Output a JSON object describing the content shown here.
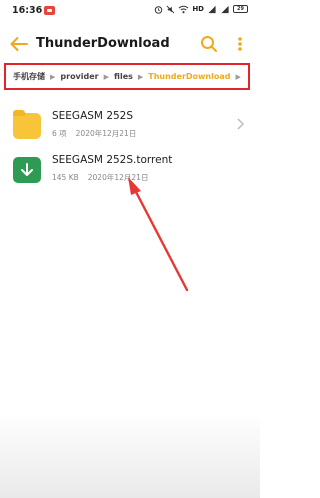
{
  "status_bar": {
    "time": "16:36",
    "network": "HD",
    "battery": "29"
  },
  "header": {
    "title": "ThunderDownload",
    "back_icon": "back-arrow-icon",
    "search_icon": "search-icon",
    "more_icon": "more-vertical-icon"
  },
  "breadcrumb": {
    "items": [
      "手机存储",
      "provider",
      "files",
      "ThunderDownload"
    ]
  },
  "files": [
    {
      "name": "SEEGASM 252S",
      "count": "6 项",
      "date": "2020年12月21日",
      "type": "folder"
    },
    {
      "name": "SEEGASM 252S.torrent",
      "size": "145 KB",
      "date": "2020年12月21日",
      "type": "torrent"
    }
  ],
  "colors": {
    "accent": "#f0a91e",
    "highlight_box": "#e0262a",
    "folder": "#f7c43a",
    "torrent": "#2f9a53"
  }
}
